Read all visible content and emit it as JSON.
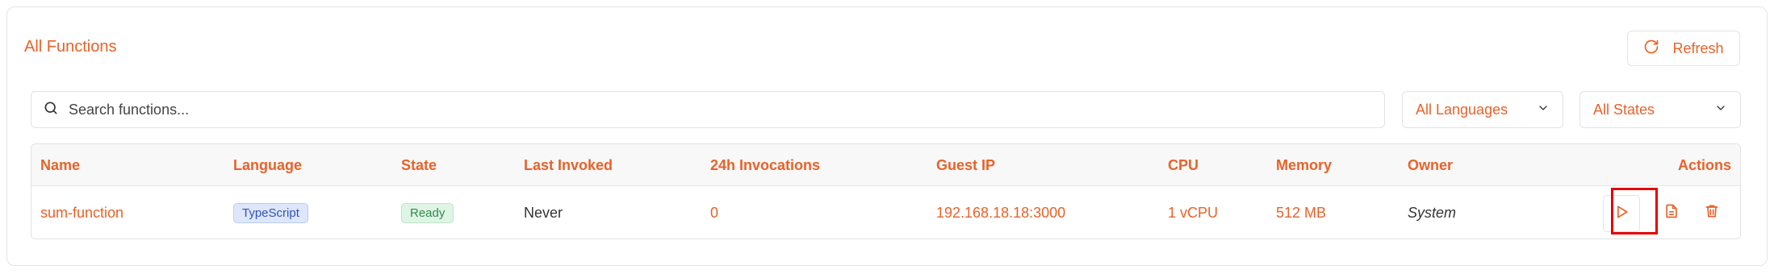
{
  "header": {
    "title": "All Functions",
    "refresh_label": "Refresh"
  },
  "filters": {
    "search_placeholder": "Search functions...",
    "language_selected": "All Languages",
    "state_selected": "All States"
  },
  "table": {
    "columns": [
      "Name",
      "Language",
      "State",
      "Last Invoked",
      "24h Invocations",
      "Guest IP",
      "CPU",
      "Memory",
      "Owner",
      "Actions"
    ],
    "rows": [
      {
        "name": "sum-function",
        "language": "TypeScript",
        "state": "Ready",
        "last_invoked": "Never",
        "invocations_24h": "0",
        "guest_ip": "192.168.18.18:3000",
        "cpu": "1 vCPU",
        "memory": "512 MB",
        "owner": "System",
        "actions": [
          "play-icon",
          "document-icon",
          "trash-icon"
        ]
      }
    ]
  },
  "colors": {
    "accent": "#e8622a",
    "typescript_badge": "#dde6fb",
    "ready_badge": "#def5e5",
    "highlight": "#e60000"
  }
}
